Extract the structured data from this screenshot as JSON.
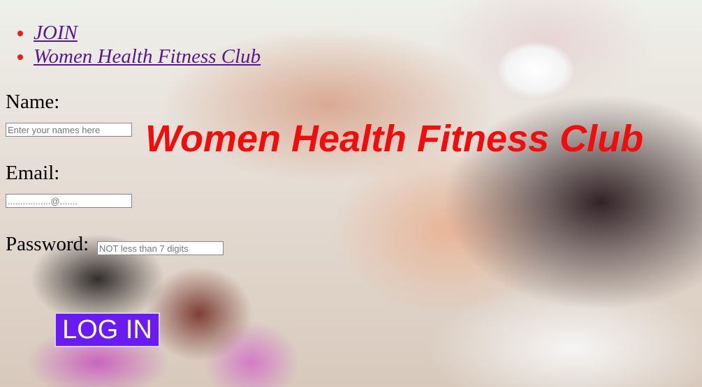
{
  "nav": {
    "items": [
      {
        "label": "JOIN"
      },
      {
        "label": "Women Health Fitness Club"
      }
    ]
  },
  "hero": {
    "title": "Women Health Fitness Club"
  },
  "form": {
    "name_label": "Name:",
    "name_placeholder": "Enter your names here",
    "email_label": "Email:",
    "email_placeholder": ".................@.......",
    "password_label": "Password:",
    "password_placeholder": "NOT less than 7 digits",
    "submit_label": "LOG IN"
  },
  "colors": {
    "hero_text": "#f20d0d",
    "link": "#551a8b",
    "bullet": "#ee1c1c",
    "button_bg": "#6a1bf4"
  }
}
